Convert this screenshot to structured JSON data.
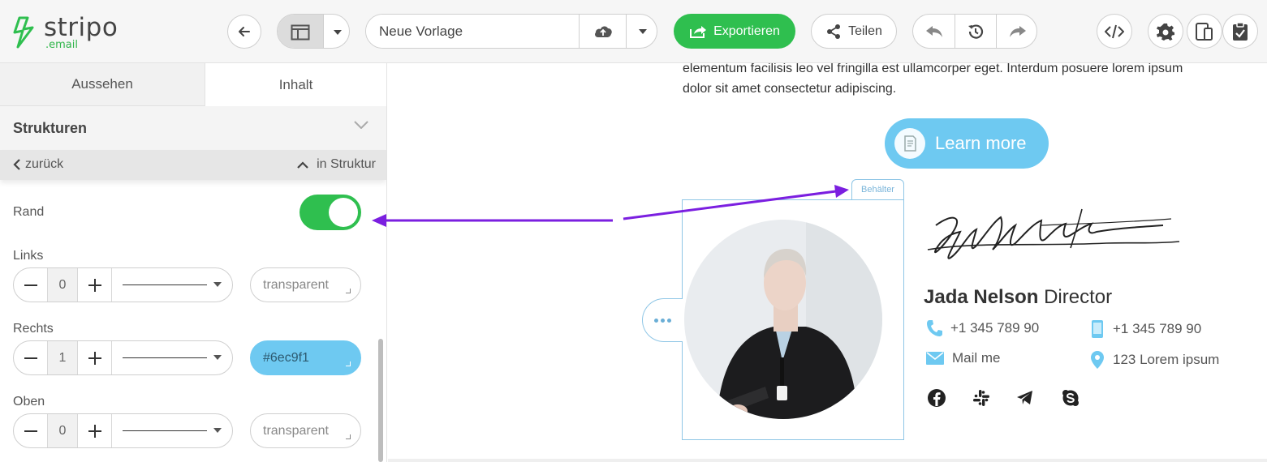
{
  "brand": {
    "name": "stripo",
    "suffix": ".email",
    "accent": "#2fbf4f"
  },
  "toolbar": {
    "template_name": "Neue Vorlage",
    "export_label": "Exportieren",
    "share_label": "Teilen"
  },
  "panel": {
    "tabs": [
      {
        "label": "Aussehen"
      },
      {
        "label": "Inhalt"
      }
    ],
    "section_title": "Strukturen",
    "back_label": "zurück",
    "in_structure_label": "in Struktur",
    "border_label": "Rand",
    "border_enabled": true,
    "sides": [
      {
        "label": "Links",
        "width": "0",
        "color": "transparent",
        "color_filled": false
      },
      {
        "label": "Rechts",
        "width": "1",
        "color": "#6ec9f1",
        "color_text": "#6ec9f1",
        "color_filled": true
      },
      {
        "label": "Oben",
        "width": "0",
        "color": "transparent",
        "color_filled": false
      }
    ]
  },
  "canvas": {
    "body_line1": "elementum facilisis leo vel fringilla est ullamcorper eget. Interdum posuere lorem ipsum",
    "body_line2": "dolor sit amet consectetur adipiscing.",
    "cta_label": "Learn more",
    "container_tag": "Behälter",
    "person_first": "Jada Nelson",
    "person_title": "Director",
    "phone1": "+1 345 789 90",
    "phone2": "+1 345 789 90",
    "email_label": "Mail me",
    "address": "123 Lorem ipsum",
    "social": [
      "facebook-icon",
      "slack-icon",
      "telegram-icon",
      "skype-icon"
    ],
    "accent": "#6ec9f1"
  },
  "annotation": {
    "arrow_color": "#7b1fe0"
  }
}
